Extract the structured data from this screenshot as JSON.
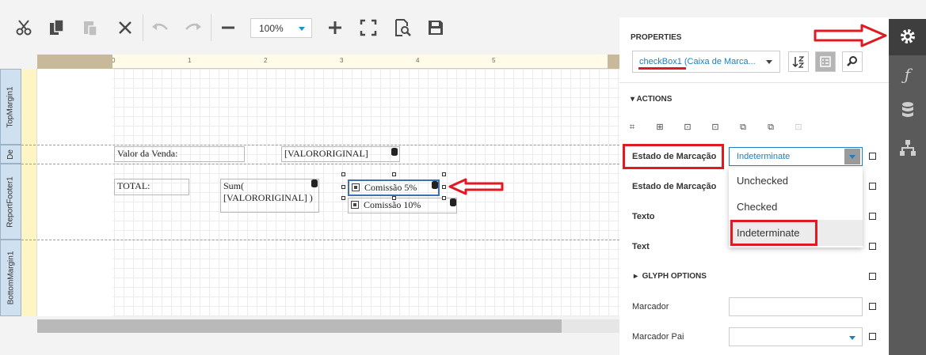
{
  "toolbar": {
    "zoom_value": "100%"
  },
  "ruler": {
    "numbers": [
      "0",
      "1",
      "2",
      "3",
      "4",
      "5"
    ]
  },
  "bands": {
    "top_margin": "TopMargin1",
    "detail": "De",
    "report_footer": "ReportFooter1",
    "bottom_margin": "BottomMargin1"
  },
  "design": {
    "valor_label": "Valor da Venda:",
    "valor_field": "[VALORORIGINAL]",
    "total_label": "TOTAL:",
    "sum_line1": "Sum(",
    "sum_line2": "[VALORORIGINAL] )",
    "checkbox1": "Comissão 5%",
    "checkbox2": "Comissão 10%"
  },
  "properties": {
    "title": "PROPERTIES",
    "selected_component": "checkBox1 (Caixa de Marca...",
    "actions_header": "ACTIONS",
    "glyph_header": "GLYPH OPTIONS",
    "rows": {
      "estado1": "Estado de Marcação",
      "estado1_value": "Indeterminate",
      "estado2": "Estado de Marcação",
      "texto": "Texto",
      "text": "Text",
      "marcador": "Marcador",
      "marcador_pai": "Marcador Pai"
    },
    "dropdown_options": [
      "Unchecked",
      "Checked",
      "Indeterminate"
    ]
  },
  "colors": {
    "accent": "#1e7fc0",
    "annotation_red": "#e01a22",
    "iconbar": "#5a5a5a"
  }
}
